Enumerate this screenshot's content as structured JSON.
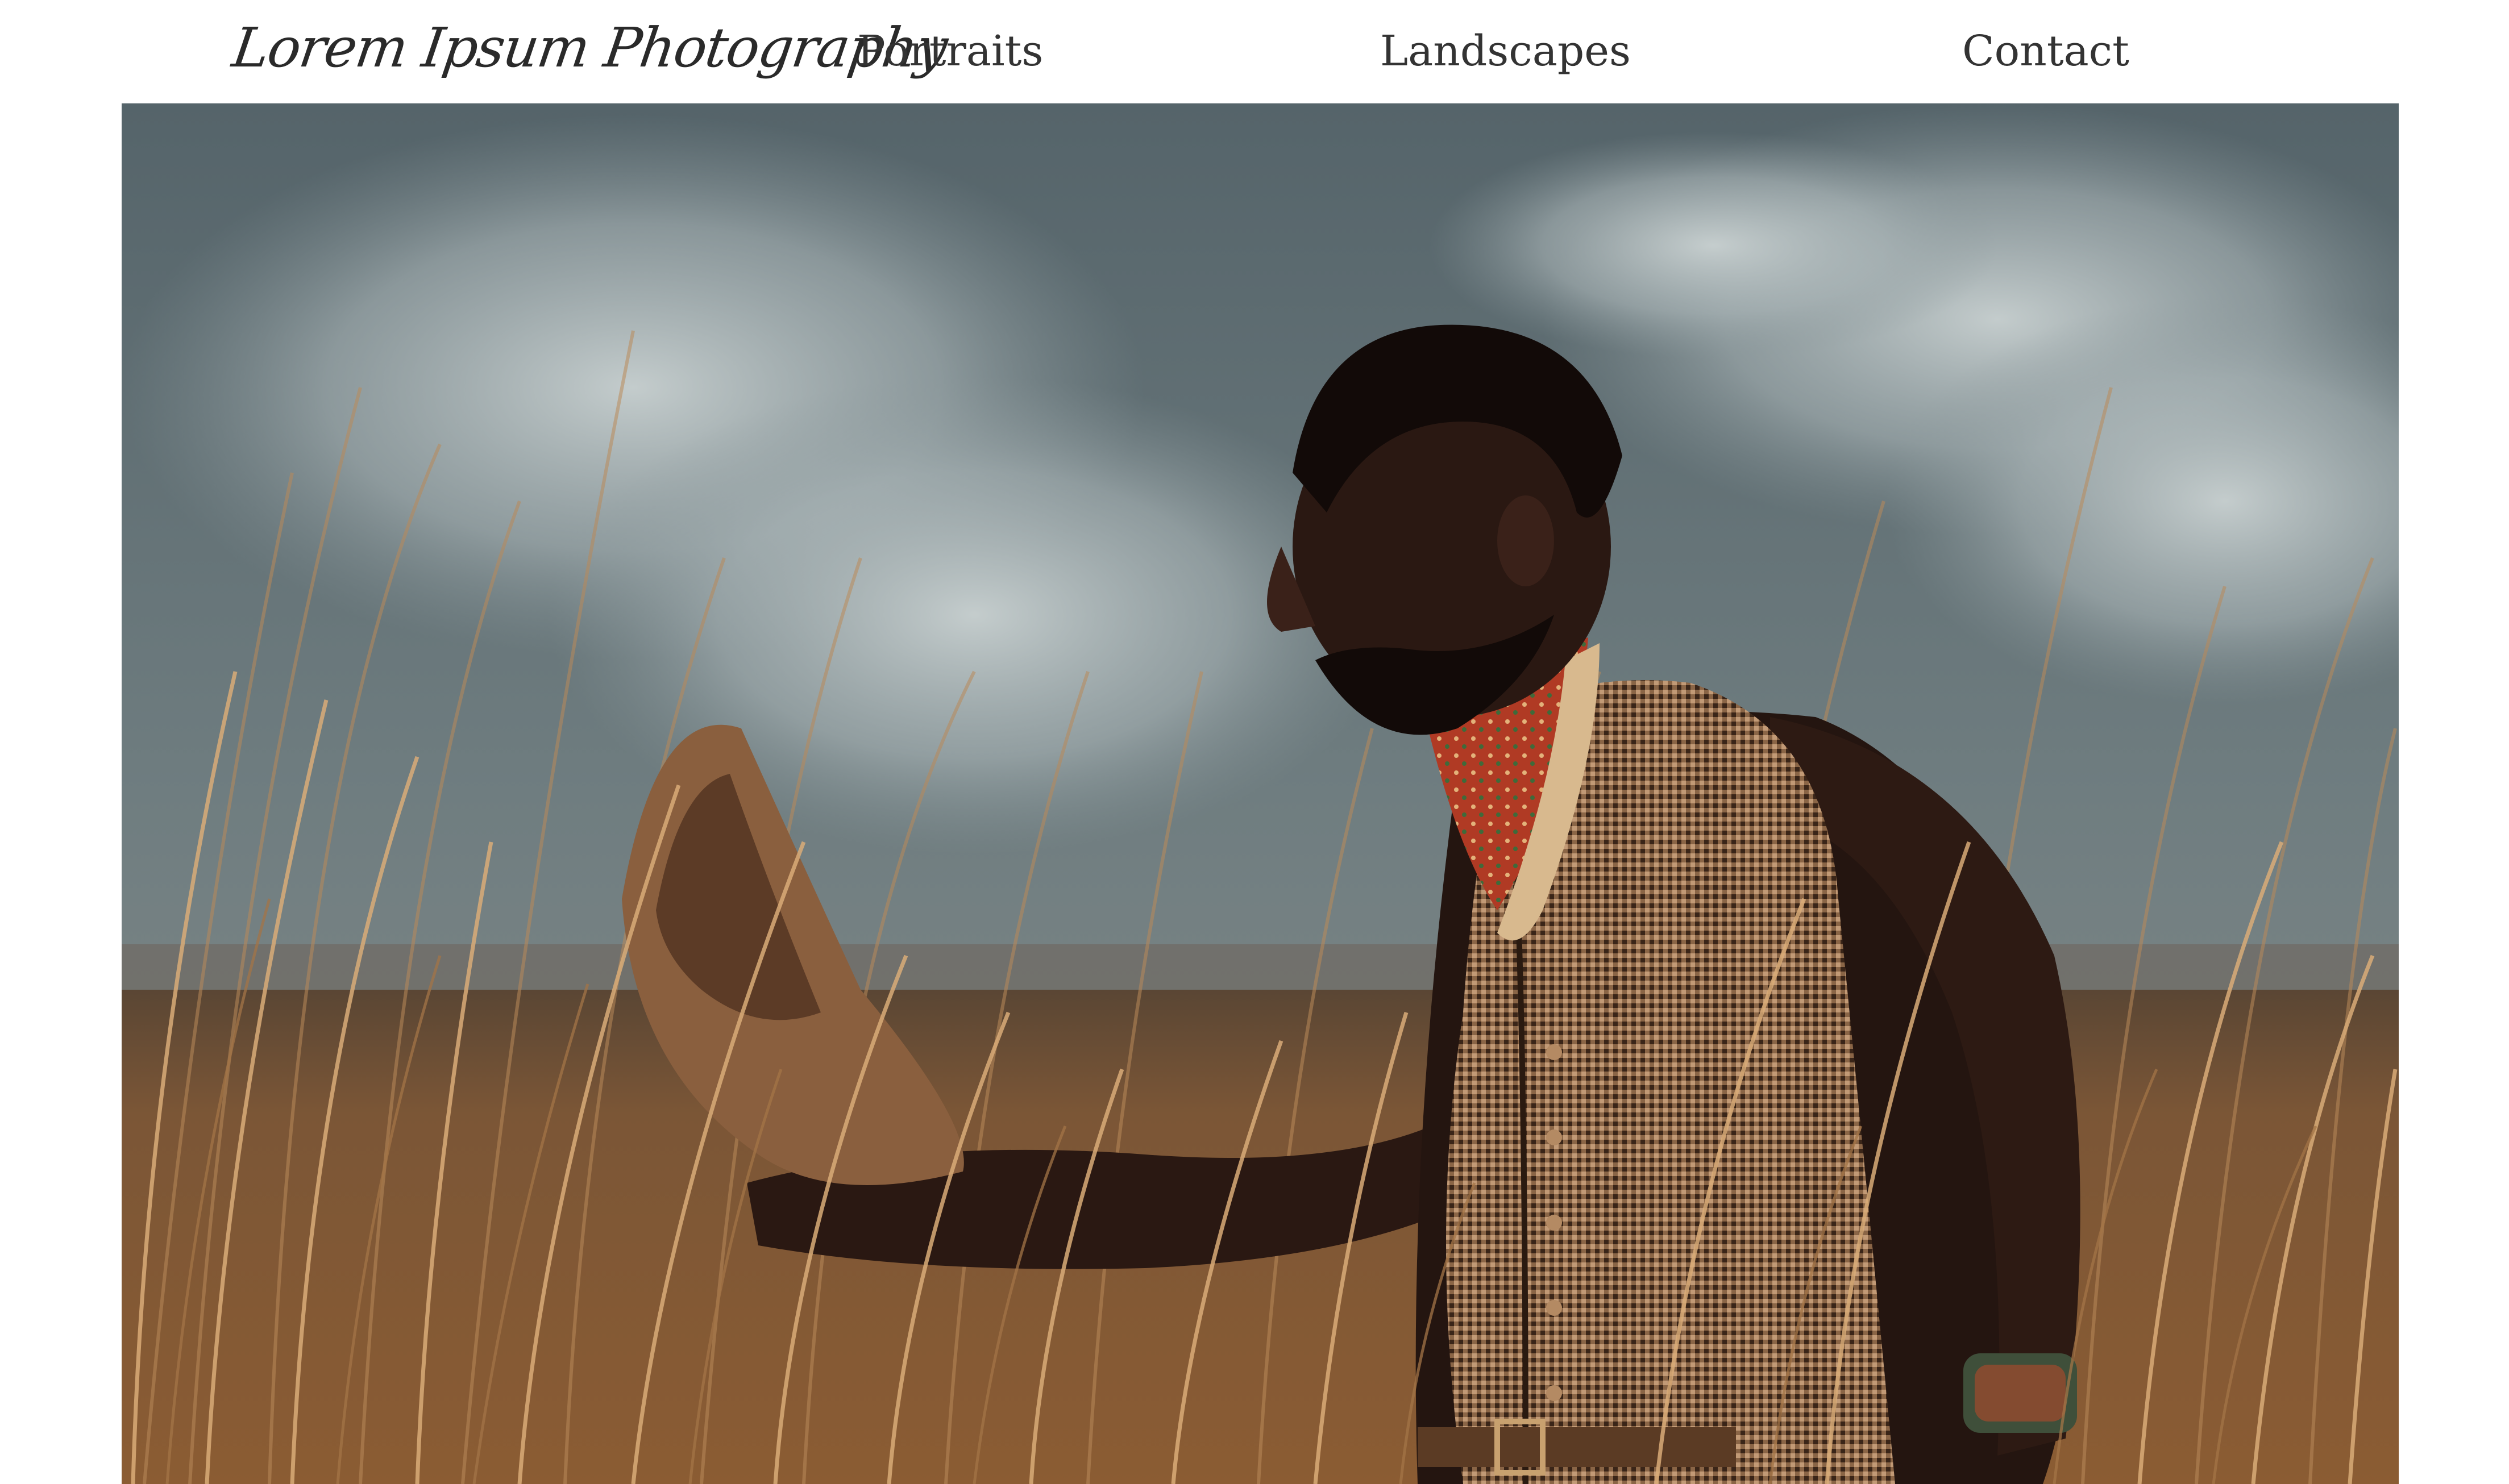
{
  "header": {
    "logo_text": "Lorem Ipsum Photography",
    "nav": [
      {
        "label": "Portraits"
      },
      {
        "label": "Landscapes"
      },
      {
        "label": "Contact"
      }
    ]
  },
  "hero": {
    "subject": "man in checked vest holding a hat in tall golden grass under a cloudy sky",
    "colors": {
      "sky": "#6b7a7e",
      "clouds": "#b9c3c4",
      "grass": "#9a6a3c",
      "grass_highlight": "#d2a574",
      "skin": "#2b1a14",
      "vest": "#7a5436",
      "scarf": "#b23a26"
    }
  }
}
